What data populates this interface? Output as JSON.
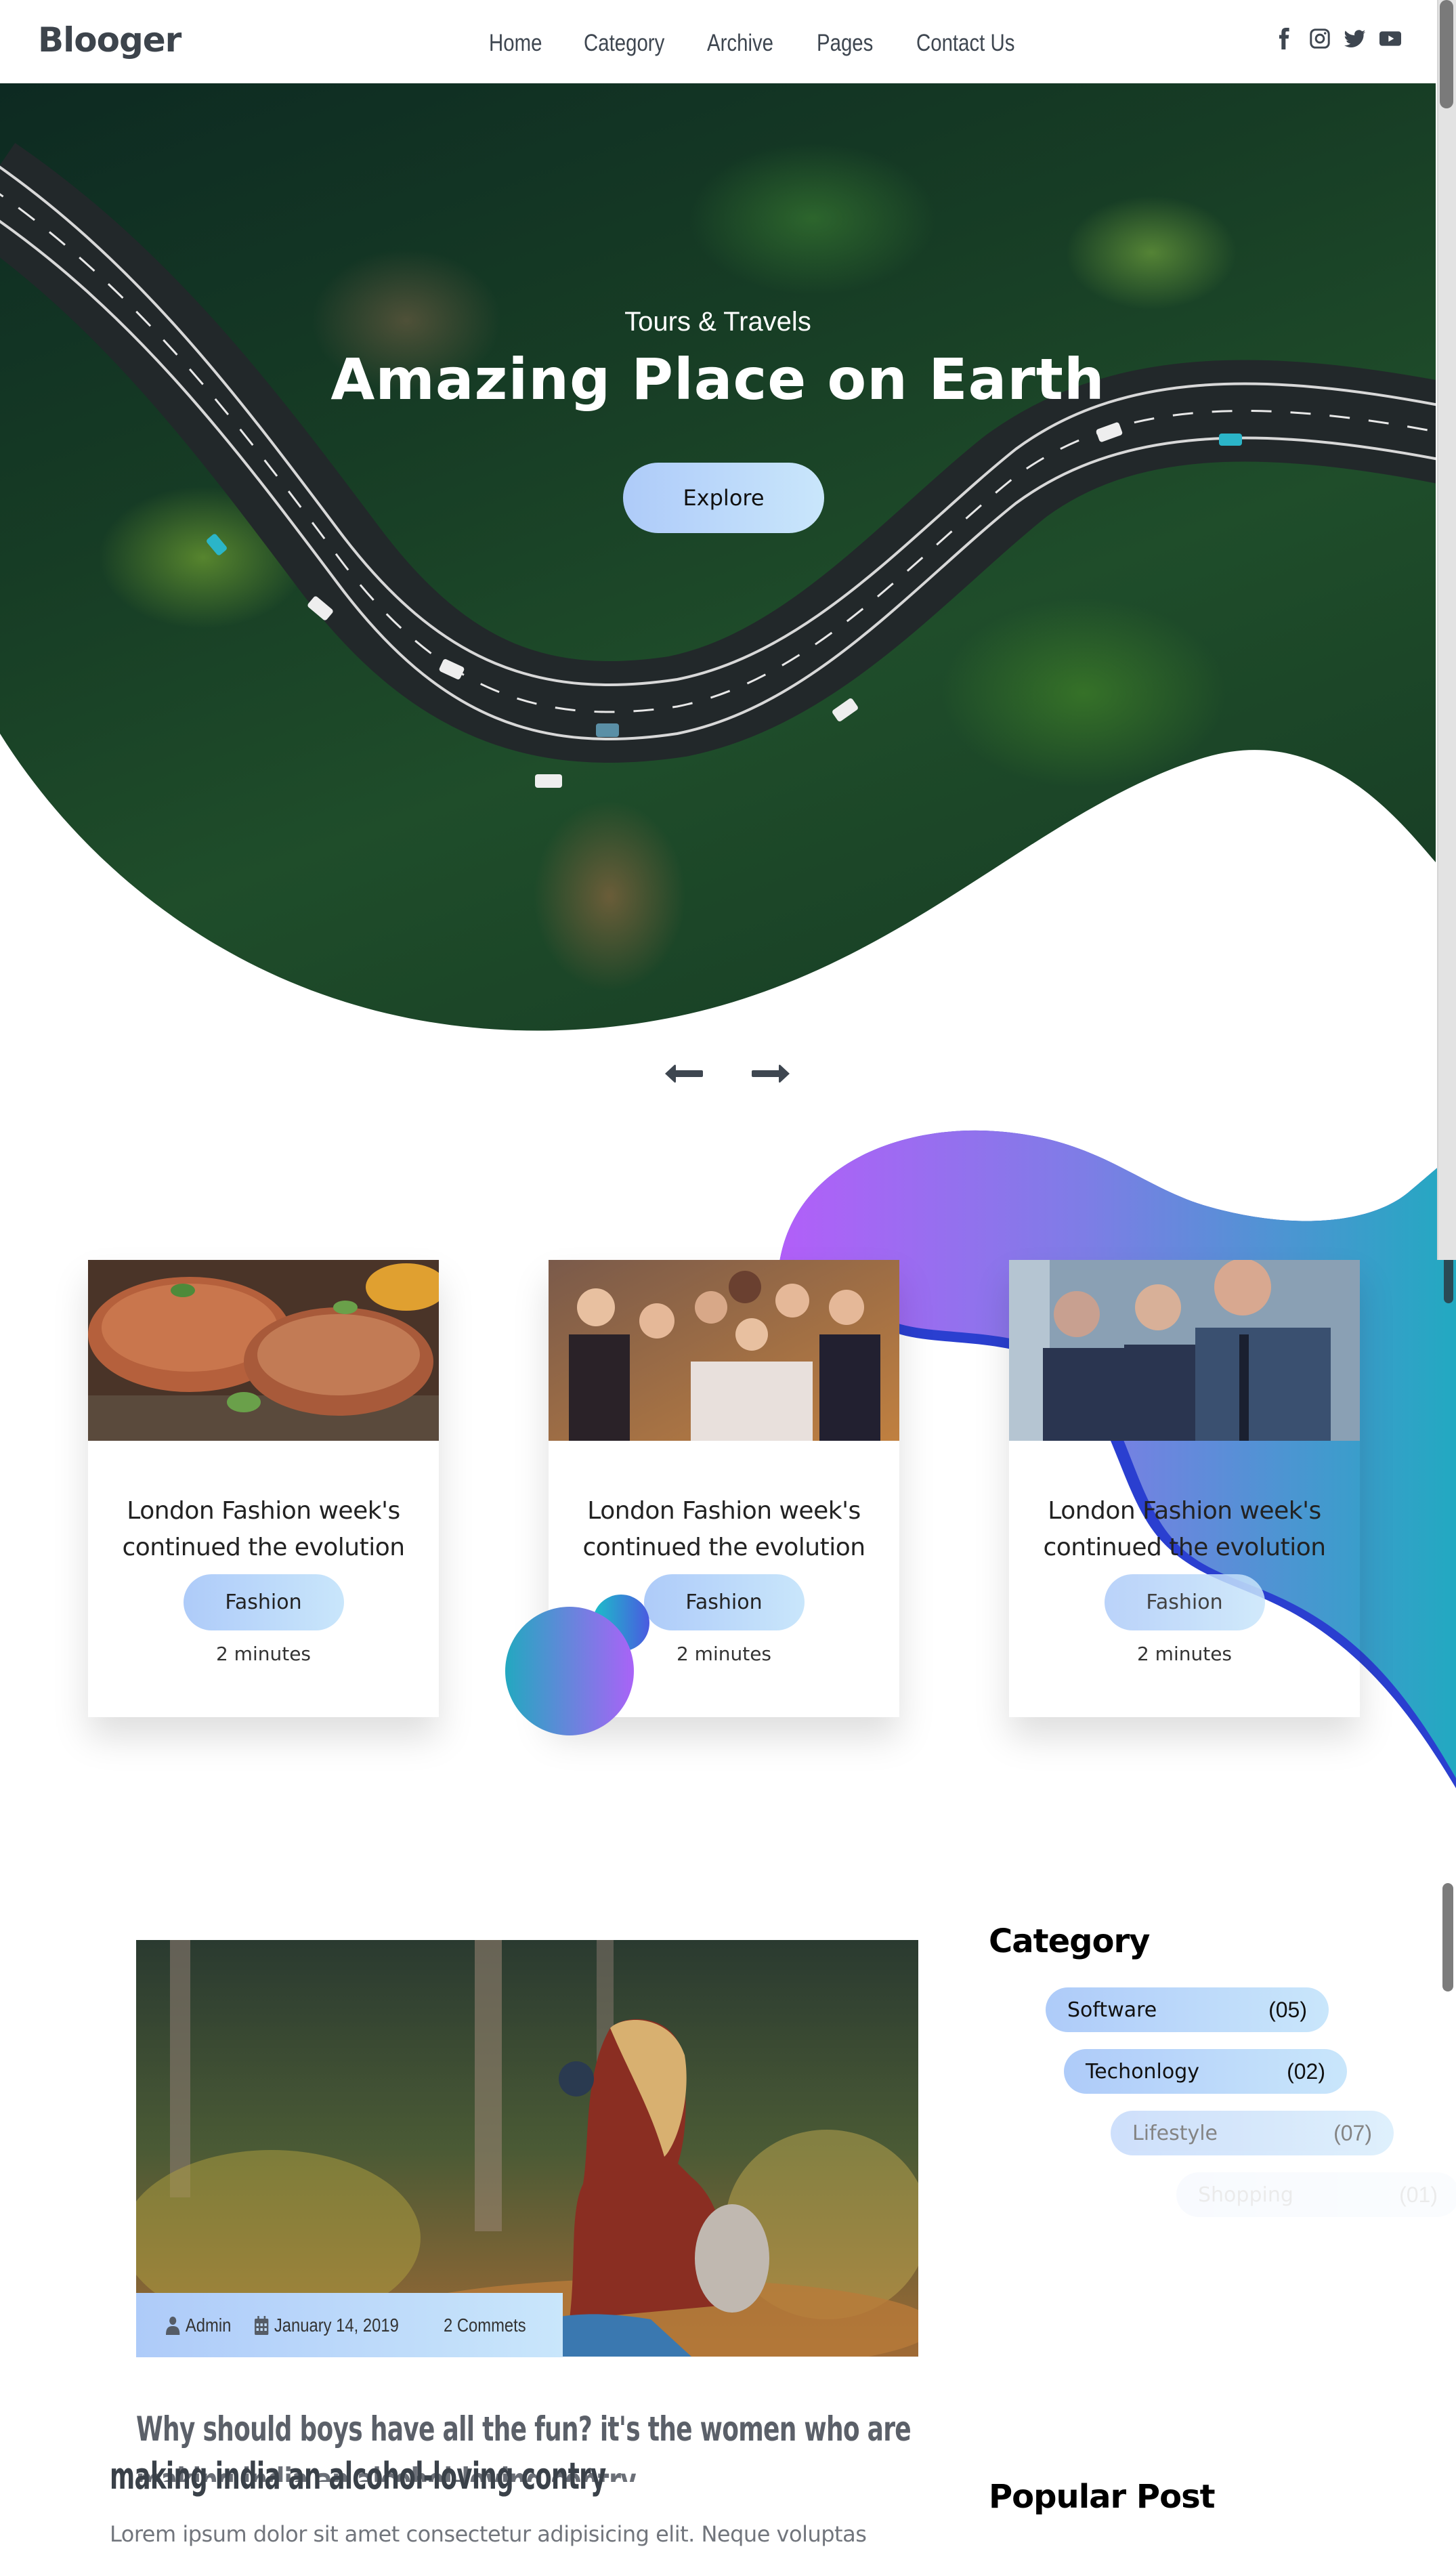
{
  "header": {
    "logo": "Blooger",
    "nav": [
      "Home",
      "Category",
      "Archive",
      "Pages",
      "Contact Us"
    ],
    "social_icons": [
      "facebook-icon",
      "instagram-icon",
      "twitter-icon",
      "youtube-icon"
    ]
  },
  "hero": {
    "subtitle": "Tours & Travels",
    "title": "Amazing Place on Earth",
    "button_label": "Explore",
    "slider_prev_icon": "arrow-left-icon",
    "slider_next_icon": "arrow-right-icon"
  },
  "featured": {
    "cards": [
      {
        "image": "grilled-steak-photo",
        "title_line1": "London Fashion week's",
        "title_line2": "continued the evolution",
        "tag": "Fashion",
        "read_time": "2 minutes"
      },
      {
        "image": "party-crowd-photo",
        "title_line1": "London Fashion week's",
        "title_line2": "continued the evolution",
        "tag": "Fashion",
        "read_time": "2 minutes"
      },
      {
        "image": "business-people-photo",
        "title_line1": "London Fashion week's",
        "title_line2": "continued the evolution",
        "tag": "Fashion",
        "read_time": "2 minutes"
      }
    ]
  },
  "post": {
    "image": "woman-photographer-forest-photo",
    "author": "Admin",
    "date": "January 14, 2019",
    "comments": "2 Commets",
    "title_line1": "Why should boys have all the fun? it's the women who are",
    "title_line2": "making india an alcohol-loving contry",
    "excerpt": "Lorem ipsum dolor sit amet consectetur adipisicing elit. Neque voluptas"
  },
  "sidebar": {
    "category_heading": "Category",
    "categories": [
      {
        "name": "Software",
        "count": "(05)"
      },
      {
        "name": "Techonlogy",
        "count": "(02)"
      },
      {
        "name": "Lifestyle",
        "count": "(07)"
      },
      {
        "name": "Shopping",
        "count": "(01)"
      }
    ],
    "popular_heading": "Popular Post"
  },
  "colors": {
    "accent_gradient_start": "#aecbf9",
    "accent_gradient_end": "#c9e6fb",
    "blob_purple": "#a963f7",
    "blob_teal": "#23a8c0",
    "blob_edge_blue": "#2a3fd0",
    "text_dark": "#3a4149"
  }
}
